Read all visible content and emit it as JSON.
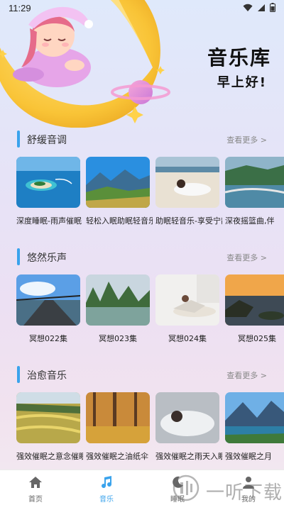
{
  "status_bar": {
    "time": "11:29"
  },
  "header": {
    "title": "音乐库",
    "greeting": "早上好!"
  },
  "sections": [
    {
      "title": "舒缓音调",
      "more": "查看更多 >",
      "items": [
        {
          "label": "深度睡眠-雨声催眠"
        },
        {
          "label": "轻松入眠助眠轻音乐"
        },
        {
          "label": "助眠轻音乐-享受宁静"
        },
        {
          "label": "深夜摇篮曲,伴"
        }
      ]
    },
    {
      "title": "悠然乐声",
      "more": "查看更多 >",
      "items": [
        {
          "label": "冥想022集"
        },
        {
          "label": "冥想023集"
        },
        {
          "label": "冥想024集"
        },
        {
          "label": "冥想025集"
        }
      ]
    },
    {
      "title": "治愈音乐",
      "more": "查看更多 >",
      "items": [
        {
          "label": "强效催眠之意念催眠"
        },
        {
          "label": "强效催眠之油纸伞"
        },
        {
          "label": "强效催眠之雨天入眠"
        },
        {
          "label": "强效催眠之月"
        }
      ]
    }
  ],
  "tab_bar": {
    "items": [
      {
        "label": "首页",
        "icon": "home-icon"
      },
      {
        "label": "音乐",
        "icon": "music-note-icon",
        "active": true
      },
      {
        "label": "睡眠",
        "icon": "moon-icon"
      },
      {
        "label": "我的",
        "icon": "person-icon"
      }
    ]
  },
  "watermark": {
    "text": "一听下载"
  },
  "colors": {
    "accent": "#3aa3ec",
    "section_bar": "#3aa3ec",
    "nav_active": "#3aa3ec"
  }
}
